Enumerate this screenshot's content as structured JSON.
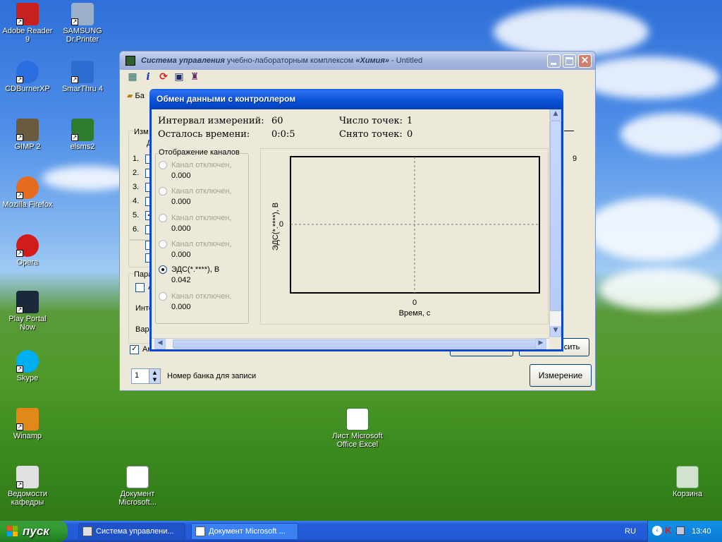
{
  "desktop": {
    "icons": [
      {
        "label": "Adobe Reader 9",
        "color": "#c8201f"
      },
      {
        "label": "SAMSUNG Dr.Printer",
        "color": "#1a4c9a"
      },
      {
        "label": "CDBurnerXP",
        "color": "#2a6ee0"
      },
      {
        "label": "SmarThru 4",
        "color": "#2b6dd1"
      },
      {
        "label": "GIMP 2",
        "color": "#6a5a40"
      },
      {
        "label": "elsms2",
        "color": "#2e7a2e"
      },
      {
        "label": "Mozilla Firefox",
        "color": "#e56b1f"
      },
      {
        "label": "Opera",
        "color": "#d21c1c"
      },
      {
        "label": "Play Portal Now",
        "color": "#1a2a3a"
      },
      {
        "label": "Skype",
        "color": "#00aff0"
      },
      {
        "label": "Winamp",
        "color": "#e0881a"
      },
      {
        "label": "Ведомости кафедры",
        "color": "#e0e0e0"
      },
      {
        "label": "Документ Microsoft...",
        "color": "#ffffff"
      },
      {
        "label": "Лист Microsoft Office Excel",
        "color": "#ffffff"
      },
      {
        "label": "Корзина",
        "color": "#6aa86a"
      }
    ]
  },
  "taskbar": {
    "start_label": "пуск",
    "buttons": [
      {
        "label": "Система управлени..."
      },
      {
        "label": "Документ Microsoft ..."
      }
    ],
    "lang": "RU",
    "clock": "13:40"
  },
  "main_window": {
    "title_prefix": "Система управления",
    "title_mid": " учебно-лабораторным комплексом ",
    "title_name": "«Химия»",
    "title_suffix": " - Untitled",
    "tab_label": "Ба",
    "group_label": "Изм",
    "group_sub": "Д",
    "rows": [
      "1.",
      "2.",
      "3.",
      "4.",
      "5.",
      "6."
    ],
    "params_label": "Пара",
    "chk_a": "А",
    "interval_label": "Инте",
    "var_label": "Вар.",
    "auto_label": "Акт",
    "clear_btn": "сить",
    "slider_value": "9",
    "bank_value": "1",
    "bank_label": "Номер банка для записи",
    "measure_btn": "Измерение"
  },
  "dialog": {
    "title": "Обмен данными с контроллером",
    "interval_label": "Интервал измерений:",
    "interval_value": "60",
    "remaining_label": "Осталось времени:",
    "remaining_value": "0:0:5",
    "points_label": "Число точек:",
    "points_value": "1",
    "taken_label": "Снято точек:",
    "taken_value": "0",
    "channels_title": "Отображение каналов",
    "channels": [
      {
        "label": "Канал отключен,",
        "value": "0.000",
        "enabled": false,
        "selected": false
      },
      {
        "label": "Канал отключен,",
        "value": "0.000",
        "enabled": false,
        "selected": false
      },
      {
        "label": "Канал отключен,",
        "value": "0.000",
        "enabled": false,
        "selected": false
      },
      {
        "label": "Канал отключен,",
        "value": "0.000",
        "enabled": false,
        "selected": false
      },
      {
        "label": "ЭДС(*.****), В",
        "value": "0.042",
        "enabled": true,
        "selected": true
      },
      {
        "label": "Канал отключен,",
        "value": "0.000",
        "enabled": false,
        "selected": false
      }
    ]
  },
  "chart_data": {
    "type": "line",
    "x": [],
    "series": [],
    "xlabel": "Время, с",
    "ylabel": "ЭДС(*.****), В",
    "x_ticks": [
      "0"
    ],
    "y_ticks": [
      "0"
    ],
    "grid": "dashed center crosshair"
  }
}
